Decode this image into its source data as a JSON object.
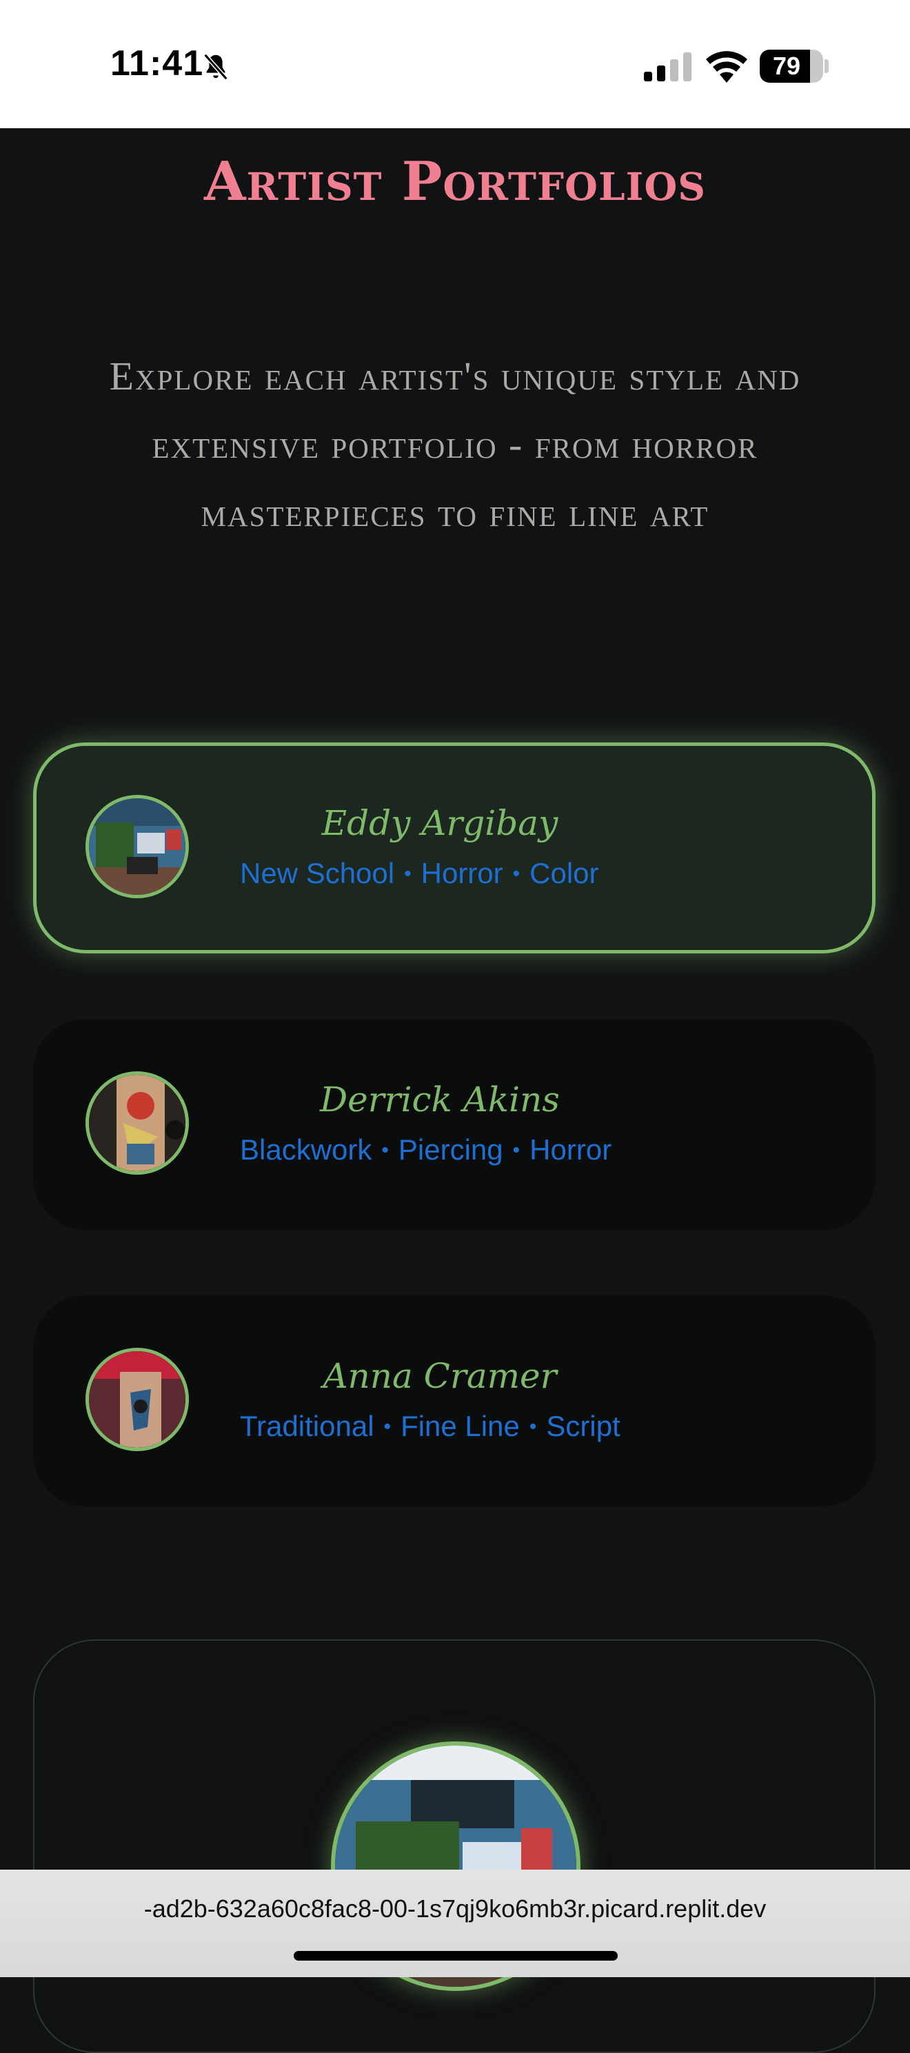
{
  "status_bar": {
    "time": "11:41",
    "battery_percent": "79",
    "battery_level": 0.79,
    "icons": [
      "bell-slash-icon",
      "cellular-signal-icon",
      "wifi-icon",
      "battery-icon"
    ]
  },
  "page": {
    "title": "Artist Portfolios",
    "intro": "Explore each artist's unique style and extensive portfolio - from horror masterpieces to fine line art"
  },
  "artists": [
    {
      "name": "Eddy Argibay",
      "tags": [
        "New School",
        "Horror",
        "Color"
      ],
      "selected": true
    },
    {
      "name": "Derrick Akins",
      "tags": [
        "Blackwork",
        "Piercing",
        "Horror"
      ],
      "selected": false
    },
    {
      "name": "Anna Cramer",
      "tags": [
        "Traditional",
        "Fine Line",
        "Script"
      ],
      "selected": false
    }
  ],
  "browser": {
    "url": "-ad2b-632a60c8fac8-00-1s7qj9ko6mb3r.picard.replit.dev"
  },
  "colors": {
    "background": "#111214",
    "title_pink": "#f07f92",
    "accent_green": "#7fb96a",
    "tag_blue": "#1e6fd4",
    "intro_gray": "#a9aba5"
  }
}
